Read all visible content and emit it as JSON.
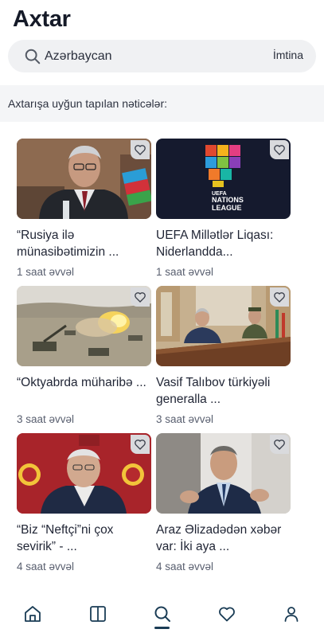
{
  "header": {
    "title": "Axtar"
  },
  "search": {
    "value": "Azərbaycan",
    "cancel_label": "İmtina",
    "icon": "search-icon"
  },
  "results": {
    "heading": "Axtarışa uyğun tapılan nəticələr:",
    "items": [
      {
        "title": "“Rusiya ilə münasibətimizin ...",
        "time": "1 saat əvvəl",
        "image": "official-with-azerbaijan-flag"
      },
      {
        "title": "UEFA Millətlər Liqası: Niderlandda...",
        "time": "1 saat əvvəl",
        "image": "uefa-nations-league-logo",
        "logo_text": [
          "UEFA",
          "NATIONS",
          "LEAGUE"
        ]
      },
      {
        "title": "“Oktyabrda müharibə ...",
        "time": "3 saat əvvəl",
        "image": "artillery-firing"
      },
      {
        "title": "Vasif Talıbov türkiyəli generalla ...",
        "time": "3 saat əvvəl",
        "image": "meeting-room"
      },
      {
        "title": "“Biz “Neftçi”ni çox sevirik” - ...",
        "time": "4 saat əvvəl",
        "image": "galatasaray-official"
      },
      {
        "title": "Araz Əlizadədən xəbər var: İki aya ...",
        "time": "4 saat əvvəl",
        "image": "speaker-gesturing"
      }
    ]
  },
  "tabbar": {
    "tabs": [
      {
        "icon": "home-icon"
      },
      {
        "icon": "book-icon"
      },
      {
        "icon": "search-icon",
        "active": true
      },
      {
        "icon": "heart-icon"
      },
      {
        "icon": "profile-icon"
      }
    ]
  },
  "colors": {
    "accent": "#1a3c55",
    "text": "#1f2434",
    "muted": "#5a6070",
    "search_bg": "#f0f1f3"
  }
}
